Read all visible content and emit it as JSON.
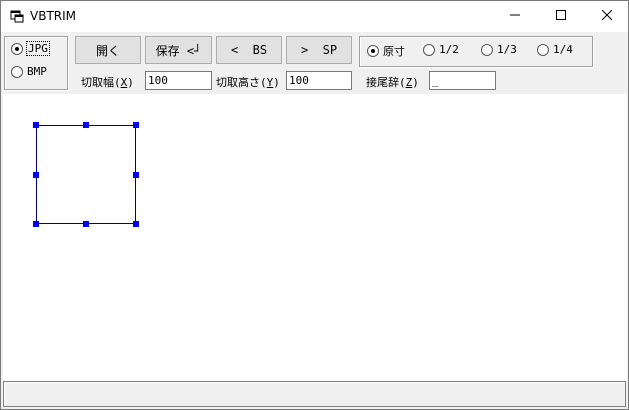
{
  "window": {
    "title": "VBTRIM",
    "icon": "app-window-icon",
    "controls": {
      "minimize": "minimize-icon",
      "maximize": "maximize-icon",
      "close": "close-icon"
    }
  },
  "format": {
    "options": [
      {
        "label": "JPG",
        "selected": true
      },
      {
        "label": "BMP",
        "selected": false
      }
    ]
  },
  "toolbar": {
    "open_label": "開く",
    "save_label": "保存 <┘",
    "back_label": "<  BS",
    "forward_label": ">  SP"
  },
  "scale": {
    "options": [
      {
        "label": "原寸",
        "selected": true
      },
      {
        "label": "1/2",
        "selected": false
      },
      {
        "label": "1/3",
        "selected": false
      },
      {
        "label": "1/4",
        "selected": false
      }
    ]
  },
  "fields": {
    "width": {
      "label": "切取幅(",
      "accel": "X",
      "suffix": ")",
      "value": "100"
    },
    "height": {
      "label": "切取高さ(",
      "accel": "Y",
      "suffix": ")",
      "value": "100"
    },
    "suffix": {
      "label": "接尾辞(",
      "accel": "Z",
      "suffix": ")",
      "value": "_"
    }
  },
  "selection": {
    "handle_color": "#0000ff",
    "border_color": "#000080"
  },
  "status": {
    "text": ""
  }
}
